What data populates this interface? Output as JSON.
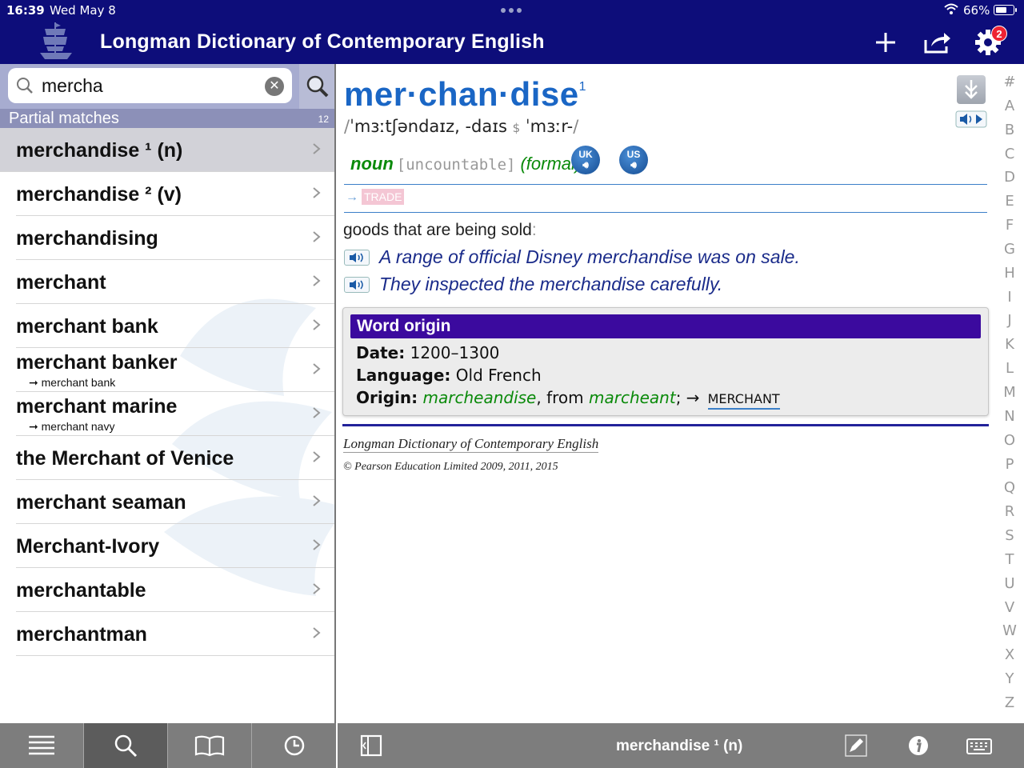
{
  "status": {
    "time": "16:39",
    "date": "Wed May 8",
    "battery": "66%",
    "battery_level": 0.66
  },
  "app": {
    "title": "Longman Dictionary of Contemporary English",
    "settings_badge": "2"
  },
  "search": {
    "value": "mercha",
    "placeholder": ""
  },
  "partial": {
    "label": "Partial matches",
    "count": "12"
  },
  "results": [
    {
      "title": "merchandise ¹ (n)",
      "sub": ""
    },
    {
      "title": "merchandise ² (v)",
      "sub": ""
    },
    {
      "title": "merchandising",
      "sub": ""
    },
    {
      "title": "merchant",
      "sub": ""
    },
    {
      "title": "merchant bank",
      "sub": ""
    },
    {
      "title": "merchant banker",
      "sub": "➞ merchant bank"
    },
    {
      "title": "merchant marine",
      "sub": "➞ merchant navy"
    },
    {
      "title": "the Merchant of Venice",
      "sub": ""
    },
    {
      "title": "merchant seaman",
      "sub": ""
    },
    {
      "title": "Merchant-Ivory",
      "sub": ""
    },
    {
      "title": "merchantable",
      "sub": ""
    },
    {
      "title": "merchantman",
      "sub": ""
    }
  ],
  "entry": {
    "headword": "mer·chan·dise",
    "homograph": "1",
    "pron_uk": "ˈmɜːtʃəndaɪz, -daɪs",
    "pron_us_mark": "$",
    "pron_us": "ˈmɜːr-",
    "pos": "noun",
    "grammar": "[uncountable]",
    "register": "(formal)",
    "uk_label": "UK",
    "us_label": "US",
    "crossref_arrow": "→",
    "crossref": "TRADE",
    "definition": "goods that are being sold",
    "definition_punct": ":",
    "examples": [
      "A range of official Disney merchandise was on sale.",
      "They inspected the merchandise carefully."
    ],
    "origin": {
      "title": "Word origin",
      "date_label": "Date:",
      "date": "1200–1300",
      "language_label": "Language:",
      "language": "Old French",
      "origin_label": "Origin:",
      "word1": "marcheandise",
      "from": ", from ",
      "word2": "marcheant",
      "tail": "; →",
      "link": "MERCHANT"
    },
    "credit": "Longman Dictionary of Contemporary English",
    "copyright": "© Pearson Education Limited 2009, 2011, 2015"
  },
  "alphabet": [
    "#",
    "A",
    "B",
    "C",
    "D",
    "E",
    "F",
    "G",
    "H",
    "I",
    "J",
    "K",
    "L",
    "M",
    "N",
    "O",
    "P",
    "Q",
    "R",
    "S",
    "T",
    "U",
    "V",
    "W",
    "X",
    "Y",
    "Z"
  ],
  "bottom": {
    "current_entry": "merchandise ¹ (n)"
  },
  "colors": {
    "header": "#0d0d7a",
    "headword": "#1a66c5",
    "origin_title": "#3b0a9e",
    "pos": "#0a8a0a",
    "example": "#1a2b8a"
  }
}
